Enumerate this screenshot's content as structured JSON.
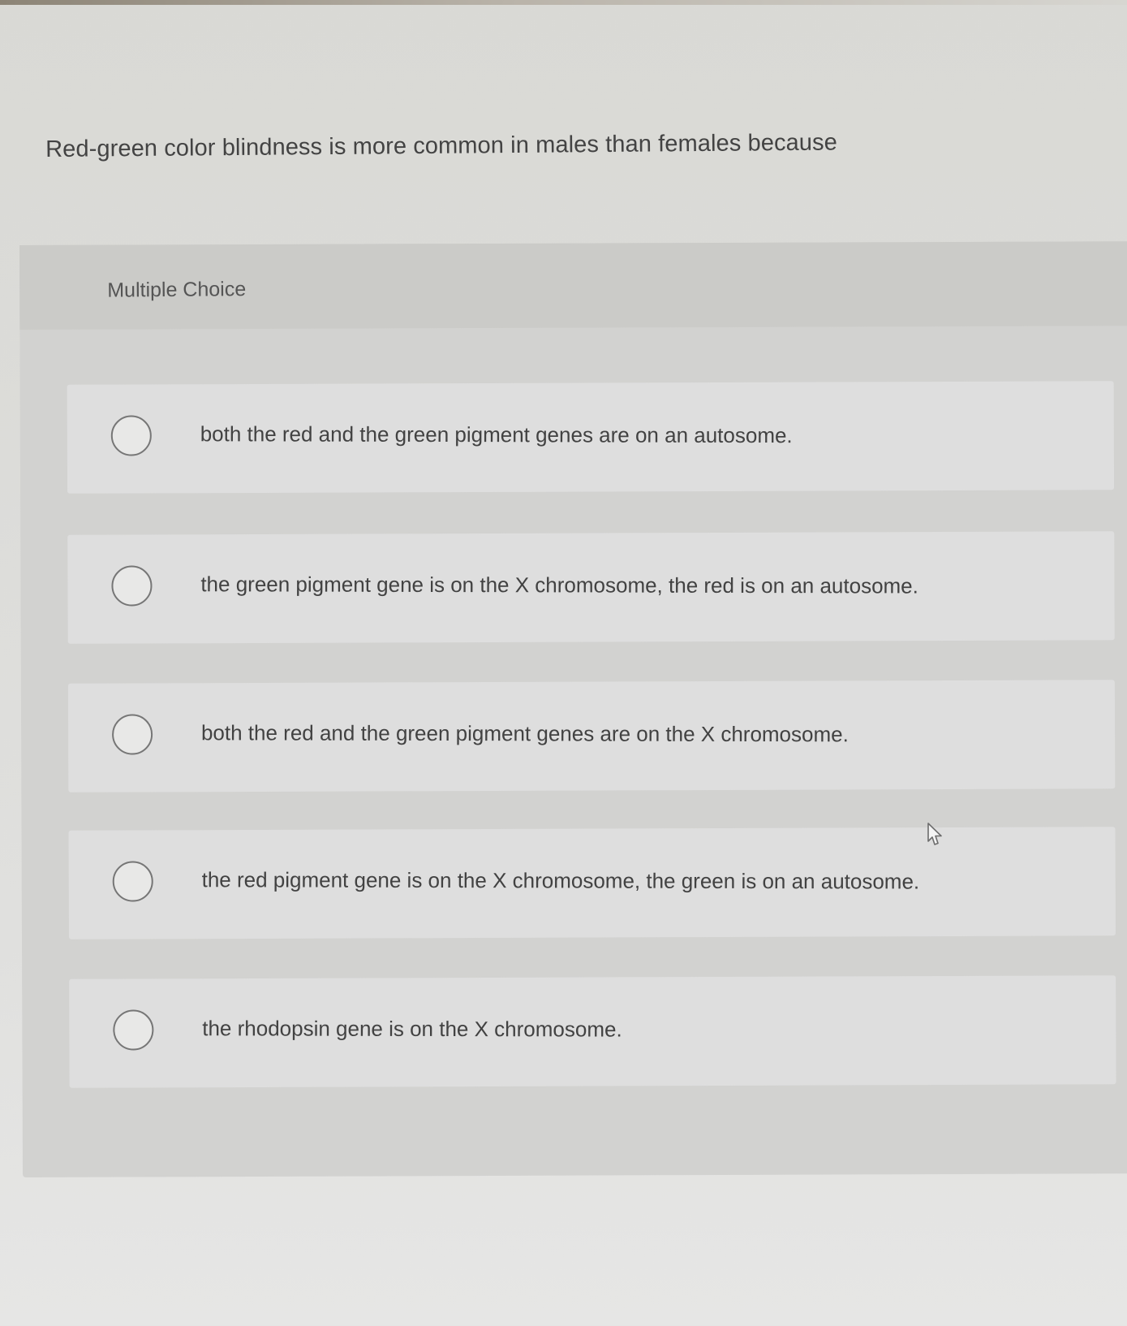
{
  "question": {
    "text": "Red-green color blindness is more common in males than females because"
  },
  "answer_panel": {
    "label": "Multiple Choice",
    "options": [
      {
        "text": "both the red and the green pigment genes are on an autosome."
      },
      {
        "text": "the green pigment gene is on the X chromosome, the red is on an autosome."
      },
      {
        "text": "both the red and the green pigment genes are on the X chromosome."
      },
      {
        "text": "the red pigment gene is on the X chromosome, the green is on an autosome."
      },
      {
        "text": "the rhodopsin gene is on the X chromosome."
      }
    ]
  },
  "icons": {
    "cursor": "mouse-pointer-icon",
    "radio": "radio-circle-icon"
  },
  "colors": {
    "page_background": "#dcdcd9",
    "panel_background": "#d2d2d0",
    "option_background": "#dedede",
    "text": "#434343",
    "radio_border": "#767676"
  }
}
